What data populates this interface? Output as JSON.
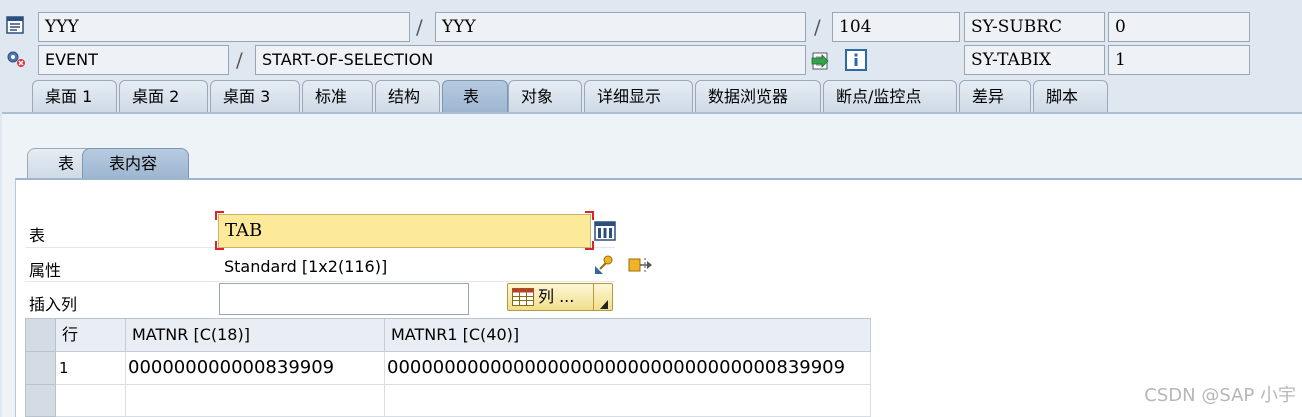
{
  "header": {
    "row1": {
      "field1": "YYY",
      "field2": "YYY",
      "field3": "104",
      "sys_label": "SY-SUBRC",
      "sys_value": "0"
    },
    "row2": {
      "field1": "EVENT",
      "field2": "START-OF-SELECTION",
      "sys_label": "SY-TABIX",
      "sys_value": "1"
    },
    "separator": "/"
  },
  "tabs": [
    {
      "label": "桌面 1"
    },
    {
      "label": "桌面 2"
    },
    {
      "label": "桌面 3"
    },
    {
      "label": "标准"
    },
    {
      "label": "结构"
    },
    {
      "label": "表",
      "active": true
    },
    {
      "label": "对象"
    },
    {
      "label": "详细显示"
    },
    {
      "label": "数据浏览器"
    },
    {
      "label": "断点/监控点"
    },
    {
      "label": "差异"
    },
    {
      "label": "脚本"
    }
  ],
  "subtabs": [
    {
      "label": "表"
    },
    {
      "label": "表内容",
      "active": true
    }
  ],
  "form": {
    "table_label": "表",
    "table_value": "TAB",
    "attr_label": "属性",
    "attr_value": "Standard [1x2(116)]",
    "insert_label": "插入列",
    "insert_value": "",
    "col_button": "列 ..."
  },
  "grid": {
    "columns": [
      "行",
      "MATNR [C(18)]",
      "MATNR1 [C(40)]"
    ],
    "rows": [
      [
        "1",
        "000000000000839909",
        "0000000000000000000000000000000000839909"
      ],
      [
        "",
        "",
        ""
      ]
    ]
  },
  "watermark": "CSDN @SAP 小宇",
  "colors": {
    "background": "#dfe8f1",
    "active_tab": "#9db6d0",
    "input_highlight": "#fde99a",
    "button_gold": "#f1df8c"
  },
  "icons": [
    "source-code-icon",
    "event-gear-icon",
    "navigate-green-icon",
    "info-icon",
    "column-settings-icon",
    "key-attributes-icon",
    "export-icon",
    "grid-icon",
    "dropdown-arrow-icon"
  ]
}
